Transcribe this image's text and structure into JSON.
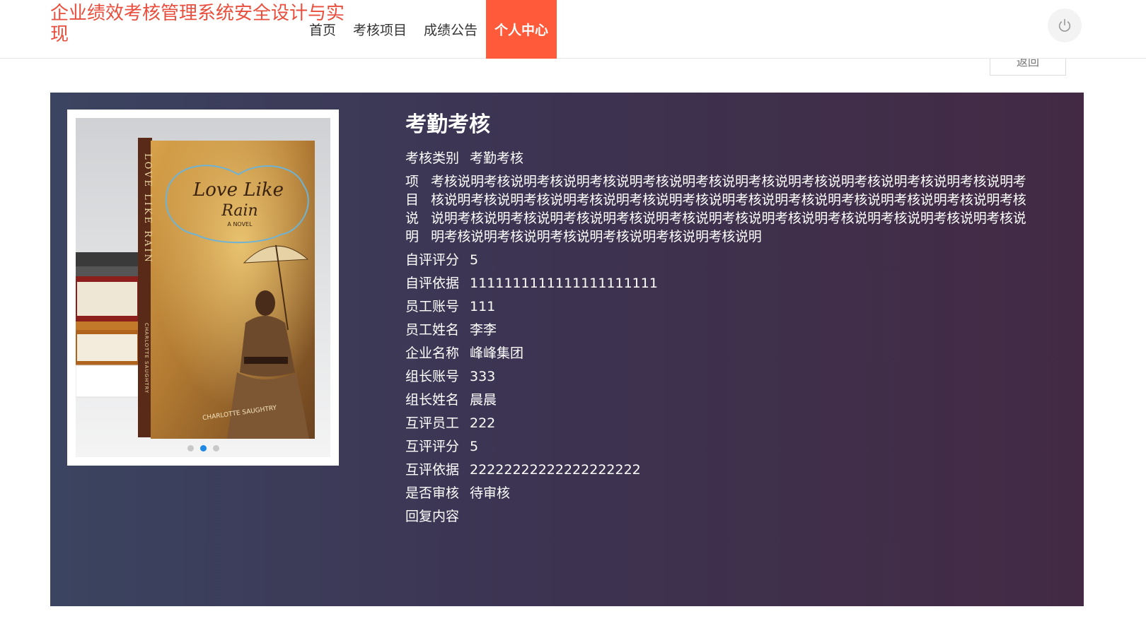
{
  "header": {
    "site_title": "企业绩效考核管理系统安全设计与实现",
    "nav": [
      "首页",
      "考核项目",
      "成绩公告",
      "个人中心"
    ],
    "active_index": 3
  },
  "return_label": "返回",
  "detail": {
    "title": "考勤考核",
    "fields": [
      {
        "label": "考核类别",
        "value": "考勤考核"
      },
      {
        "label": "项目说明",
        "value": "考核说明考核说明考核说明考核说明考核说明考核说明考核说明考核说明考核说明考核说明考核说明考核说明考核说明考核说明考核说明考核说明考核说明考核说明考核说明考核说明考核说明考核说明考核说明考核说明考核说明考核说明考核说明考核说明考核说明考核说明考核说明考核说明考核说明考核说明考核说明考核说明考核说明考核说明考核说明考核说明"
      },
      {
        "label": "自评评分",
        "value": "5"
      },
      {
        "label": "自评依据",
        "value": "1111111111111111111111"
      },
      {
        "label": "员工账号",
        "value": "111"
      },
      {
        "label": "员工姓名",
        "value": "李李"
      },
      {
        "label": "企业名称",
        "value": "峰峰集团"
      },
      {
        "label": "组长账号",
        "value": "333"
      },
      {
        "label": "组长姓名",
        "value": "晨晨"
      },
      {
        "label": "互评员工",
        "value": "222"
      },
      {
        "label": "互评评分",
        "value": "5"
      },
      {
        "label": "互评依据",
        "value": "22222222222222222222"
      },
      {
        "label": "是否审核",
        "value": "待审核"
      },
      {
        "label": "回复内容",
        "value": ""
      }
    ]
  },
  "book": {
    "title_line1": "Love Like",
    "title_line2": "Rain",
    "subtitle": "A NOVEL",
    "spine": "LOVE LIKE RAIN",
    "spine_author": "CHARLOTTE SAUGHTRY",
    "author": "CHARLOTTE SAUGHTRY"
  },
  "carousel": {
    "count": 3,
    "active": 1
  },
  "colors": {
    "brand_red": "#e94e3c",
    "active_nav": "#ff5a3a",
    "panel_start": "#3b4460",
    "panel_end": "#432a44",
    "active_dot": "#1e88e5"
  },
  "icons": {
    "power": "power-icon"
  }
}
